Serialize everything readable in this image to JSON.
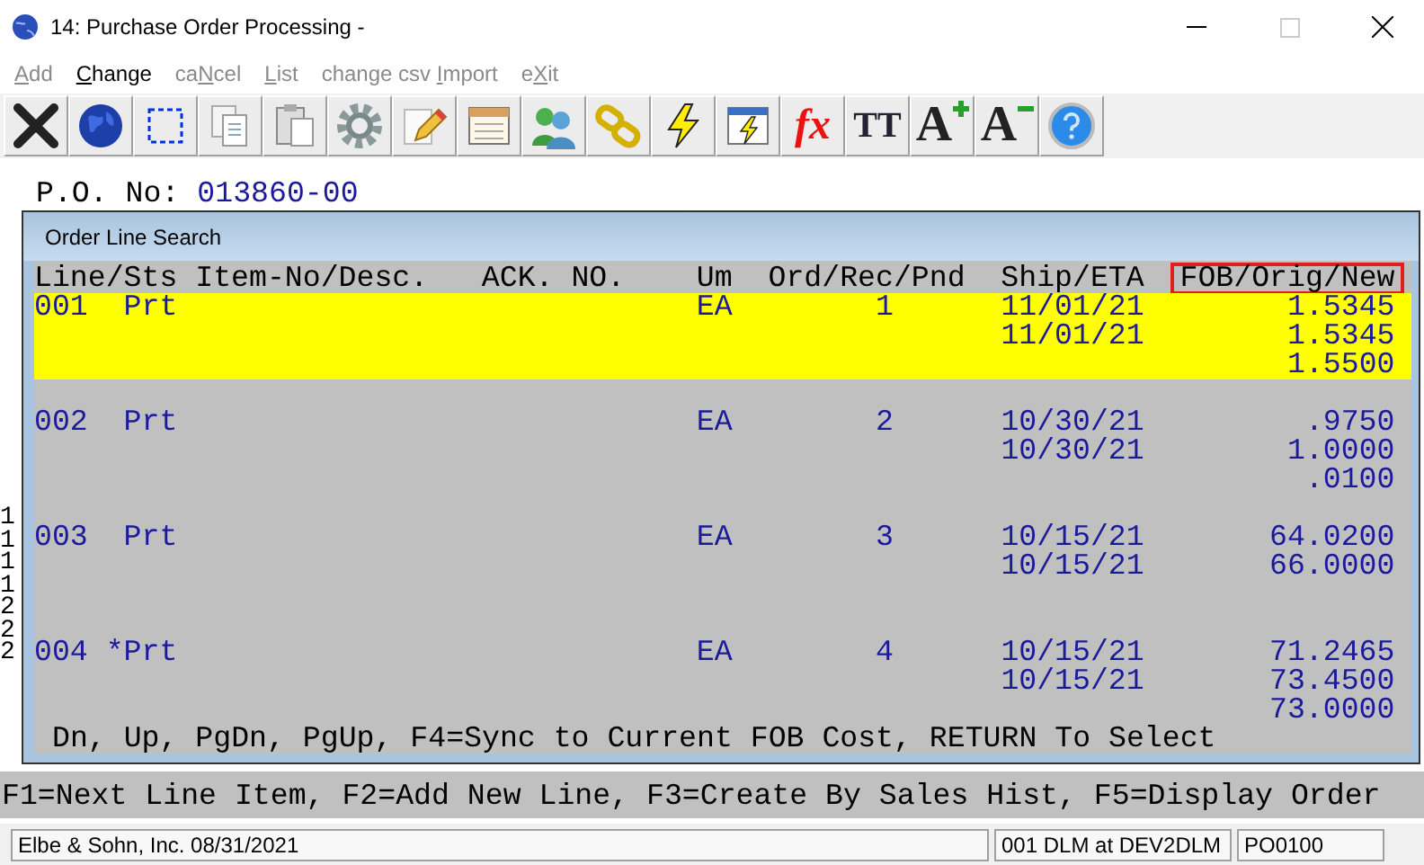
{
  "window": {
    "title": "14: Purchase Order Processing -"
  },
  "menu": [
    {
      "key": "A",
      "after": "dd",
      "disabled": true
    },
    {
      "key": "C",
      "after": "hange",
      "disabled": false
    },
    {
      "before": "ca",
      "key": "N",
      "after": "cel",
      "disabled": true
    },
    {
      "key": "L",
      "after": "ist",
      "disabled": true
    },
    {
      "before": "change csv ",
      "key": "I",
      "after": "mport",
      "disabled": true
    },
    {
      "before": "e",
      "key": "X",
      "after": "it",
      "disabled": true
    }
  ],
  "toolbar": [
    {
      "kind": "close"
    },
    {
      "kind": "globe"
    },
    {
      "kind": "select"
    },
    {
      "kind": "copy"
    },
    {
      "kind": "paste"
    },
    {
      "kind": "gear"
    },
    {
      "kind": "edit"
    },
    {
      "kind": "window"
    },
    {
      "kind": "users"
    },
    {
      "kind": "link"
    },
    {
      "kind": "bolt"
    },
    {
      "kind": "window-bolt"
    },
    {
      "kind": "glyph",
      "glyph": "fx"
    },
    {
      "kind": "glyph",
      "glyph": "TT"
    },
    {
      "kind": "font-up",
      "glyph": "A"
    },
    {
      "kind": "font-down",
      "glyph": "A"
    },
    {
      "kind": "help"
    }
  ],
  "screen": {
    "po_label": "P.O. No:",
    "po_number": "013860-00",
    "left_fragments": [
      "1",
      "1",
      "1",
      "1",
      "2",
      "2",
      "2"
    ],
    "function_keys": "F1=Next Line Item, F2=Add New Line, F3=Create By Sales Hist, F5=Display Order"
  },
  "dialog": {
    "title": "Order Line Search",
    "columns": [
      {
        "label": "Line/Sts",
        "highlighted": false
      },
      {
        "label": "Item-No/Desc.",
        "highlighted": false
      },
      {
        "label": "ACK. NO.",
        "highlighted": false
      },
      {
        "label": "Um",
        "highlighted": false
      },
      {
        "label": "Ord/Rec/Pnd",
        "highlighted": false
      },
      {
        "label": "Ship/ETA",
        "highlighted": false
      },
      {
        "label": "FOB/Orig/New",
        "highlighted": true
      }
    ],
    "rows": [
      {
        "line": "001",
        "status": "Prt",
        "um": "EA",
        "qty": "1",
        "ship": [
          "11/01/21",
          "11/01/21"
        ],
        "fob": [
          "1.5345",
          "1.5345",
          "1.5500"
        ],
        "selected": true
      },
      {
        "line": "002",
        "status": "Prt",
        "um": "EA",
        "qty": "2",
        "ship": [
          "10/30/21",
          "10/30/21"
        ],
        "fob": [
          ".9750",
          "1.0000",
          ".0100"
        ],
        "selected": false
      },
      {
        "line": "003",
        "status": "Prt",
        "um": "EA",
        "qty": "3",
        "ship": [
          "10/15/21",
          "10/15/21"
        ],
        "fob": [
          "64.0200",
          "66.0000"
        ],
        "selected": false
      },
      {
        "line": "004",
        "status": "*Prt",
        "um": "EA",
        "qty": "4",
        "ship": [
          "10/15/21",
          "10/15/21"
        ],
        "fob": [
          "71.2465",
          "73.4500",
          "73.0000"
        ],
        "selected": false
      }
    ],
    "footer": "Dn, Up, PgDn, PgUp, F4=Sync to Current FOB Cost, RETURN To Select"
  },
  "status_bar": [
    "Elbe & Sohn, Inc. 08/31/2021",
    "001 DLM at DEV2DLM",
    "PO0100"
  ]
}
